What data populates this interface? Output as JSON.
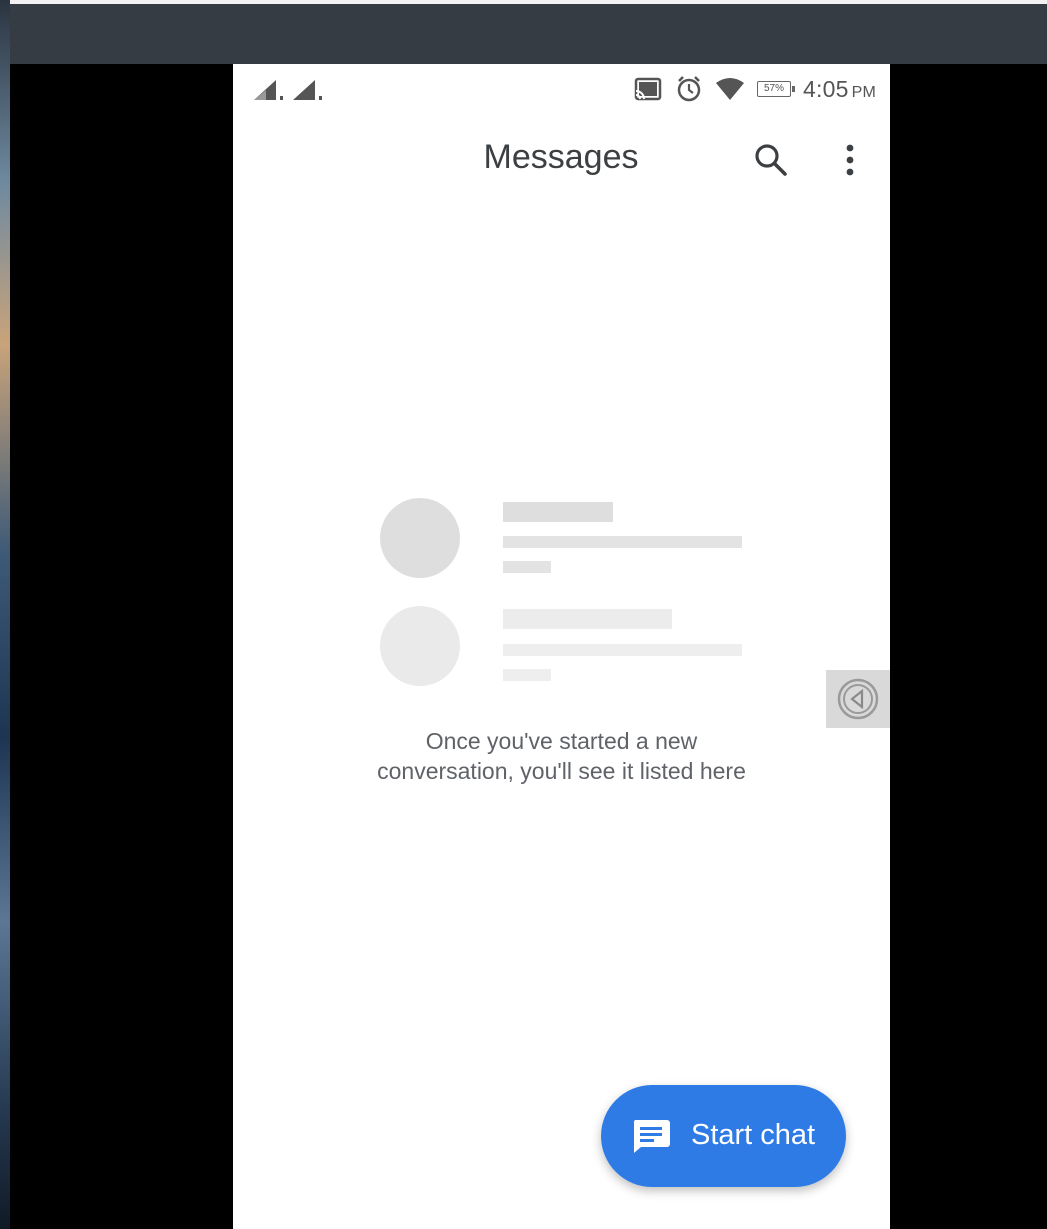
{
  "status_bar": {
    "time": "4:05",
    "ampm": "PM",
    "battery": "57%",
    "icons": [
      "signal-icon",
      "signal-icon",
      "cast-icon",
      "alarm-icon",
      "wifi-icon",
      "battery-icon"
    ]
  },
  "app_bar": {
    "title": "Messages",
    "search_icon": "search-icon",
    "more_icon": "more-vert-icon"
  },
  "empty_state": {
    "line1": "Once you've started a new",
    "line2": "conversation, you'll see it listed here"
  },
  "fab": {
    "label": "Start chat",
    "icon": "chat-bubble-icon"
  },
  "colors": {
    "accent": "#2f7be6",
    "text_primary": "#3c4043",
    "text_secondary": "#5f6368",
    "placeholder_dark": "#dedede",
    "placeholder_light": "#eaeaea"
  }
}
